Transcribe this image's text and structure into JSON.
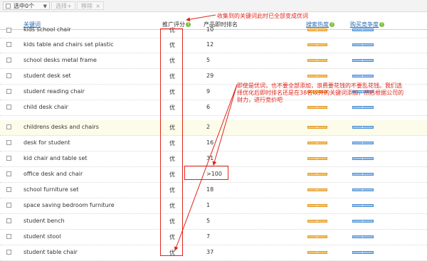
{
  "toolbar": {
    "select_label": "选中0个",
    "select_caret": "▼",
    "select_btn": "选择",
    "select_btn_icon": "+",
    "remove_btn": "移除",
    "remove_btn_icon": "×"
  },
  "header": {
    "keyword": "关键词",
    "rating": "推广评分",
    "rank": "产品即时排名",
    "heat": "搜索热度",
    "competition": "购买竞争度"
  },
  "annotations": {
    "top": "收集到的关键词此时已全部变成优词",
    "middle": "即使是优词，也不要全部添加，浪费要花钱的不要乱花钱。我们选择优化后即时排名还是在38名以外的关键词添加，然后根据公司的财力，进行竞价吧"
  },
  "colors": {
    "annotation": "#e0241a",
    "link": "#2b6bb5",
    "heat_bar": "#f7c46b",
    "competition_bar": "#9cc6ef",
    "highlight_row": "#fdfcea",
    "help_icon": "#7bbf3a"
  },
  "icons": {
    "help": "question-circle-icon",
    "checkbox": "checkbox-icon"
  },
  "rows": [
    {
      "keyword": "kids school chair",
      "rating": "优",
      "rank": "10"
    },
    {
      "keyword": "kids table and chairs set plastic",
      "rating": "优",
      "rank": "12"
    },
    {
      "keyword": "school desks metal frame",
      "rating": "优",
      "rank": "5"
    },
    {
      "keyword": "student desk set",
      "rating": "优",
      "rank": "29"
    },
    {
      "keyword": "student reading chair",
      "rating": "优",
      "rank": "9"
    },
    {
      "keyword": "child desk chair",
      "rating": "优",
      "rank": "6"
    },
    {
      "keyword": "childrens desks and chairs",
      "rating": "优",
      "rank": "2"
    },
    {
      "keyword": "desk for student",
      "rating": "优",
      "rank": "16"
    },
    {
      "keyword": "kid chair and table set",
      "rating": "优",
      "rank": "31"
    },
    {
      "keyword": "office desk and chair",
      "rating": "优",
      "rank": ">100"
    },
    {
      "keyword": "school furniture set",
      "rating": "优",
      "rank": "18"
    },
    {
      "keyword": "space saving bedroom furniture",
      "rating": "优",
      "rank": "1"
    },
    {
      "keyword": "student bench",
      "rating": "优",
      "rank": "5"
    },
    {
      "keyword": "student stool",
      "rating": "优",
      "rank": "7"
    },
    {
      "keyword": "student table chair",
      "rating": "优",
      "rank": "37"
    }
  ]
}
